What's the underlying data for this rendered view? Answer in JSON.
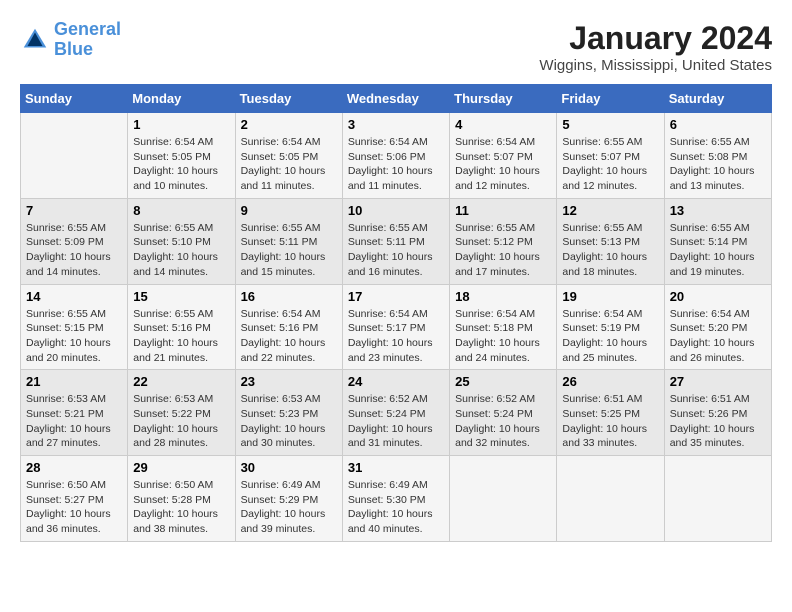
{
  "logo": {
    "line1": "General",
    "line2": "Blue"
  },
  "title": "January 2024",
  "location": "Wiggins, Mississippi, United States",
  "days_of_week": [
    "Sunday",
    "Monday",
    "Tuesday",
    "Wednesday",
    "Thursday",
    "Friday",
    "Saturday"
  ],
  "weeks": [
    [
      {
        "num": "",
        "sunrise": "",
        "sunset": "",
        "daylight": ""
      },
      {
        "num": "1",
        "sunrise": "Sunrise: 6:54 AM",
        "sunset": "Sunset: 5:05 PM",
        "daylight": "Daylight: 10 hours and 10 minutes."
      },
      {
        "num": "2",
        "sunrise": "Sunrise: 6:54 AM",
        "sunset": "Sunset: 5:05 PM",
        "daylight": "Daylight: 10 hours and 11 minutes."
      },
      {
        "num": "3",
        "sunrise": "Sunrise: 6:54 AM",
        "sunset": "Sunset: 5:06 PM",
        "daylight": "Daylight: 10 hours and 11 minutes."
      },
      {
        "num": "4",
        "sunrise": "Sunrise: 6:54 AM",
        "sunset": "Sunset: 5:07 PM",
        "daylight": "Daylight: 10 hours and 12 minutes."
      },
      {
        "num": "5",
        "sunrise": "Sunrise: 6:55 AM",
        "sunset": "Sunset: 5:07 PM",
        "daylight": "Daylight: 10 hours and 12 minutes."
      },
      {
        "num": "6",
        "sunrise": "Sunrise: 6:55 AM",
        "sunset": "Sunset: 5:08 PM",
        "daylight": "Daylight: 10 hours and 13 minutes."
      }
    ],
    [
      {
        "num": "7",
        "sunrise": "Sunrise: 6:55 AM",
        "sunset": "Sunset: 5:09 PM",
        "daylight": "Daylight: 10 hours and 14 minutes."
      },
      {
        "num": "8",
        "sunrise": "Sunrise: 6:55 AM",
        "sunset": "Sunset: 5:10 PM",
        "daylight": "Daylight: 10 hours and 14 minutes."
      },
      {
        "num": "9",
        "sunrise": "Sunrise: 6:55 AM",
        "sunset": "Sunset: 5:11 PM",
        "daylight": "Daylight: 10 hours and 15 minutes."
      },
      {
        "num": "10",
        "sunrise": "Sunrise: 6:55 AM",
        "sunset": "Sunset: 5:11 PM",
        "daylight": "Daylight: 10 hours and 16 minutes."
      },
      {
        "num": "11",
        "sunrise": "Sunrise: 6:55 AM",
        "sunset": "Sunset: 5:12 PM",
        "daylight": "Daylight: 10 hours and 17 minutes."
      },
      {
        "num": "12",
        "sunrise": "Sunrise: 6:55 AM",
        "sunset": "Sunset: 5:13 PM",
        "daylight": "Daylight: 10 hours and 18 minutes."
      },
      {
        "num": "13",
        "sunrise": "Sunrise: 6:55 AM",
        "sunset": "Sunset: 5:14 PM",
        "daylight": "Daylight: 10 hours and 19 minutes."
      }
    ],
    [
      {
        "num": "14",
        "sunrise": "Sunrise: 6:55 AM",
        "sunset": "Sunset: 5:15 PM",
        "daylight": "Daylight: 10 hours and 20 minutes."
      },
      {
        "num": "15",
        "sunrise": "Sunrise: 6:55 AM",
        "sunset": "Sunset: 5:16 PM",
        "daylight": "Daylight: 10 hours and 21 minutes."
      },
      {
        "num": "16",
        "sunrise": "Sunrise: 6:54 AM",
        "sunset": "Sunset: 5:16 PM",
        "daylight": "Daylight: 10 hours and 22 minutes."
      },
      {
        "num": "17",
        "sunrise": "Sunrise: 6:54 AM",
        "sunset": "Sunset: 5:17 PM",
        "daylight": "Daylight: 10 hours and 23 minutes."
      },
      {
        "num": "18",
        "sunrise": "Sunrise: 6:54 AM",
        "sunset": "Sunset: 5:18 PM",
        "daylight": "Daylight: 10 hours and 24 minutes."
      },
      {
        "num": "19",
        "sunrise": "Sunrise: 6:54 AM",
        "sunset": "Sunset: 5:19 PM",
        "daylight": "Daylight: 10 hours and 25 minutes."
      },
      {
        "num": "20",
        "sunrise": "Sunrise: 6:54 AM",
        "sunset": "Sunset: 5:20 PM",
        "daylight": "Daylight: 10 hours and 26 minutes."
      }
    ],
    [
      {
        "num": "21",
        "sunrise": "Sunrise: 6:53 AM",
        "sunset": "Sunset: 5:21 PM",
        "daylight": "Daylight: 10 hours and 27 minutes."
      },
      {
        "num": "22",
        "sunrise": "Sunrise: 6:53 AM",
        "sunset": "Sunset: 5:22 PM",
        "daylight": "Daylight: 10 hours and 28 minutes."
      },
      {
        "num": "23",
        "sunrise": "Sunrise: 6:53 AM",
        "sunset": "Sunset: 5:23 PM",
        "daylight": "Daylight: 10 hours and 30 minutes."
      },
      {
        "num": "24",
        "sunrise": "Sunrise: 6:52 AM",
        "sunset": "Sunset: 5:24 PM",
        "daylight": "Daylight: 10 hours and 31 minutes."
      },
      {
        "num": "25",
        "sunrise": "Sunrise: 6:52 AM",
        "sunset": "Sunset: 5:24 PM",
        "daylight": "Daylight: 10 hours and 32 minutes."
      },
      {
        "num": "26",
        "sunrise": "Sunrise: 6:51 AM",
        "sunset": "Sunset: 5:25 PM",
        "daylight": "Daylight: 10 hours and 33 minutes."
      },
      {
        "num": "27",
        "sunrise": "Sunrise: 6:51 AM",
        "sunset": "Sunset: 5:26 PM",
        "daylight": "Daylight: 10 hours and 35 minutes."
      }
    ],
    [
      {
        "num": "28",
        "sunrise": "Sunrise: 6:50 AM",
        "sunset": "Sunset: 5:27 PM",
        "daylight": "Daylight: 10 hours and 36 minutes."
      },
      {
        "num": "29",
        "sunrise": "Sunrise: 6:50 AM",
        "sunset": "Sunset: 5:28 PM",
        "daylight": "Daylight: 10 hours and 38 minutes."
      },
      {
        "num": "30",
        "sunrise": "Sunrise: 6:49 AM",
        "sunset": "Sunset: 5:29 PM",
        "daylight": "Daylight: 10 hours and 39 minutes."
      },
      {
        "num": "31",
        "sunrise": "Sunrise: 6:49 AM",
        "sunset": "Sunset: 5:30 PM",
        "daylight": "Daylight: 10 hours and 40 minutes."
      },
      {
        "num": "",
        "sunrise": "",
        "sunset": "",
        "daylight": ""
      },
      {
        "num": "",
        "sunrise": "",
        "sunset": "",
        "daylight": ""
      },
      {
        "num": "",
        "sunrise": "",
        "sunset": "",
        "daylight": ""
      }
    ]
  ]
}
